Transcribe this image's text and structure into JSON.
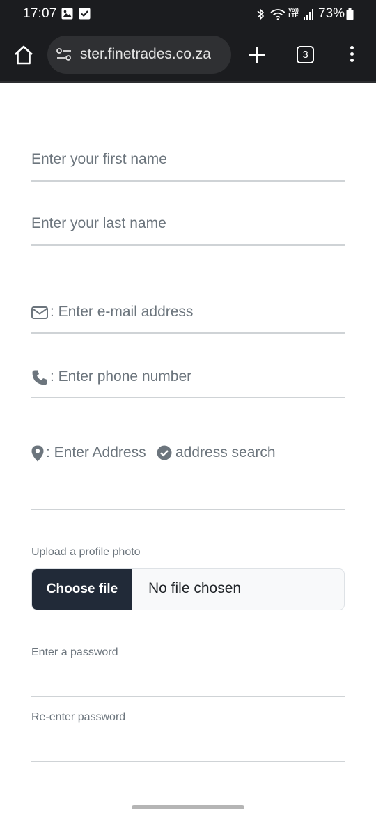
{
  "status_bar": {
    "time": "17:07",
    "volte_top": "Vo))",
    "volte_bottom": "LTE",
    "battery": "73%"
  },
  "browser": {
    "url": "ster.finetrades.co.za",
    "tab_count": "3"
  },
  "form": {
    "first_name_placeholder": "Enter your first name",
    "last_name_placeholder": "Enter your last name",
    "email_placeholder": ": Enter e-mail address",
    "phone_placeholder": ": Enter phone number",
    "address_placeholder": ": Enter Address",
    "address_search": "address search",
    "upload_label": "Upload a profile photo",
    "choose_file": "Choose file",
    "no_file": "No file chosen",
    "password_label": "Enter a password",
    "reenter_label": "Re-enter password"
  },
  "colors": {
    "chrome_bg": "#1b1c1f",
    "omnibox_bg": "#2f3033",
    "placeholder": "#6c757d",
    "field_border": "#cfd3d6",
    "file_button_bg": "#212a38"
  }
}
